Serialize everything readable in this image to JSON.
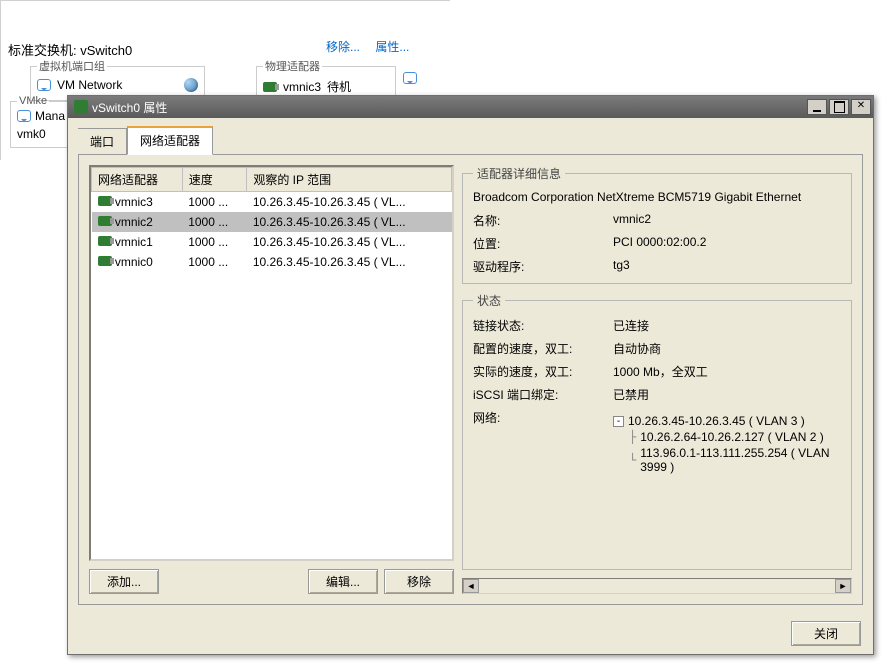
{
  "background": {
    "std_switch": "标准交换机: vSwitch0",
    "remove_link": "移除...",
    "props_link": "属性...",
    "vm_port_group": "虚拟机端口组",
    "vm_network": "VM Network",
    "physical_adapter": "物理适配器",
    "vmnic3": "vmnic3",
    "standby": "待机",
    "vmke": "VMke",
    "mana": "Mana",
    "vmk0": "vmk0"
  },
  "dialog": {
    "title": "vSwitch0 属性",
    "tabs": {
      "ports": "端口",
      "adapters": "网络适配器"
    },
    "list": {
      "cols": {
        "adapter": "网络适配器",
        "speed": "速度",
        "observed": "观察的 IP 范围"
      },
      "rows": [
        {
          "name": "vmnic3",
          "speed": "1000 ...",
          "range": "10.26.3.45-10.26.3.45 ( VL..."
        },
        {
          "name": "vmnic2",
          "speed": "1000 ...",
          "range": "10.26.3.45-10.26.3.45 ( VL..."
        },
        {
          "name": "vmnic1",
          "speed": "1000 ...",
          "range": "10.26.3.45-10.26.3.45 ( VL..."
        },
        {
          "name": "vmnic0",
          "speed": "1000 ...",
          "range": "10.26.3.45-10.26.3.45 ( VL..."
        }
      ]
    },
    "buttons": {
      "add": "添加...",
      "edit": "编辑...",
      "remove": "移除",
      "close": "关闭"
    },
    "detail": {
      "title": "适配器详细信息",
      "model": "Broadcom Corporation NetXtreme BCM5719 Gigabit Ethernet",
      "name_lbl": "名称:",
      "name_val": "vmnic2",
      "loc_lbl": "位置:",
      "loc_val": "PCI 0000:02:00.2",
      "drv_lbl": "驱动程序:",
      "drv_val": "tg3"
    },
    "status": {
      "title": "状态",
      "link_lbl": "链接状态:",
      "link_val": "已连接",
      "cfg_lbl": "配置的速度，双工:",
      "cfg_val": "自动协商",
      "act_lbl": "实际的速度，双工:",
      "act_val": "1000 Mb，全双工",
      "iscsi_lbl": "iSCSI 端口绑定:",
      "iscsi_val": "已禁用",
      "net_lbl": "网络:",
      "networks": [
        "10.26.3.45-10.26.3.45 ( VLAN 3 )",
        "10.26.2.64-10.26.2.127 ( VLAN 2 )",
        "113.96.0.1-113.111.255.254 ( VLAN 3999 )"
      ]
    }
  }
}
